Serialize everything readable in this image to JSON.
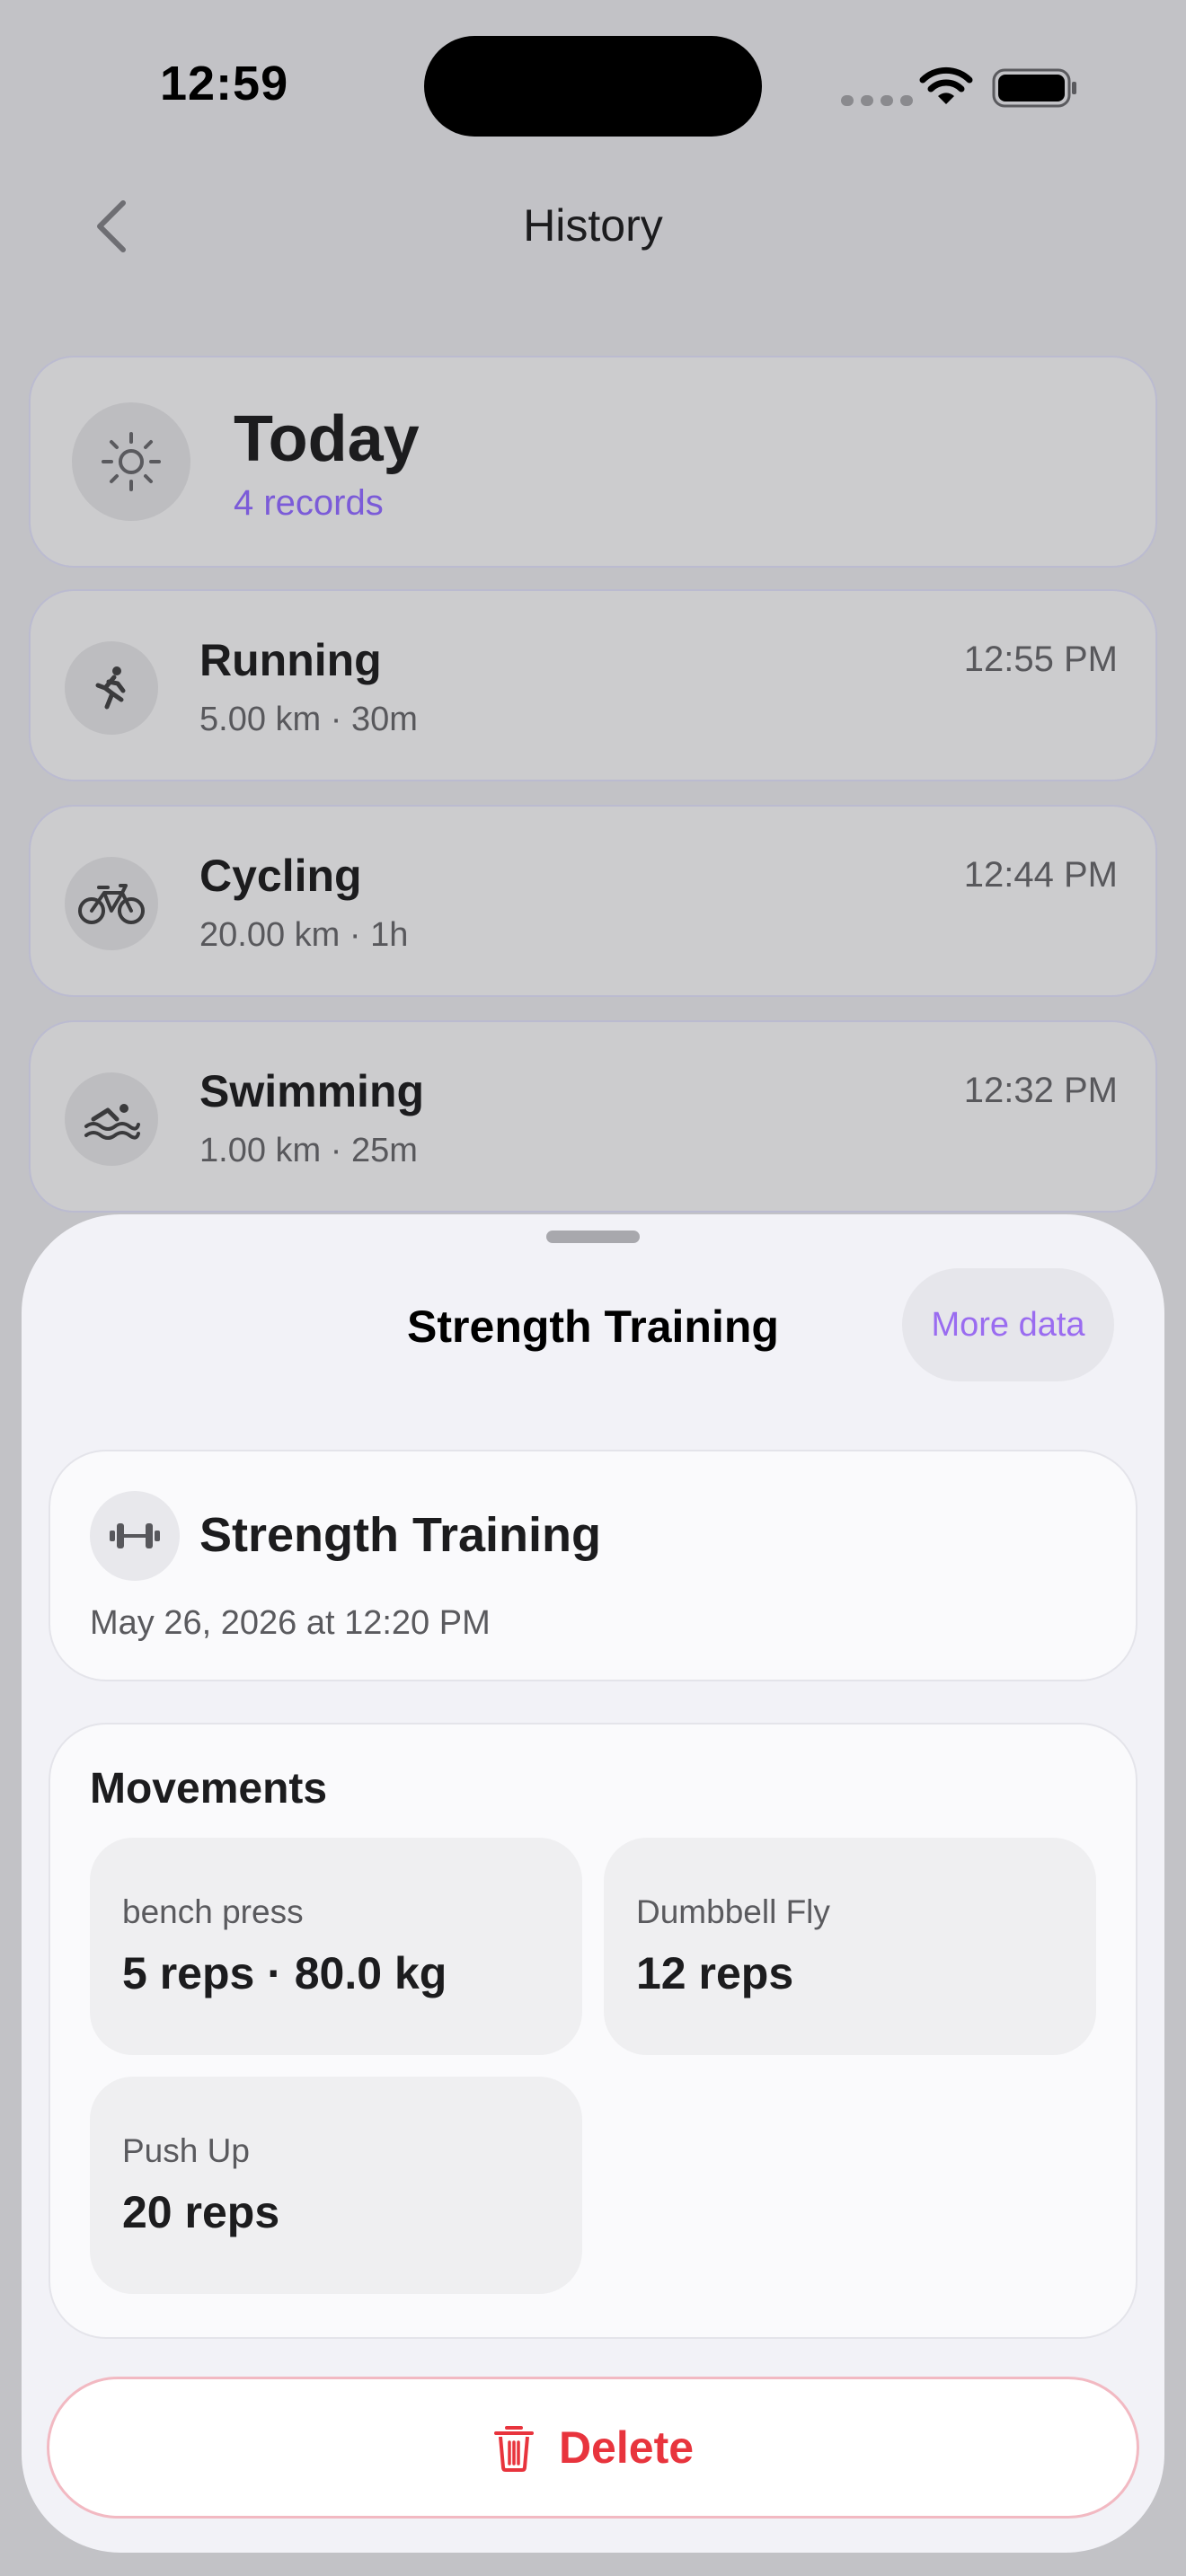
{
  "status_bar": {
    "time": "12:59"
  },
  "nav": {
    "title": "History"
  },
  "today": {
    "title": "Today",
    "count": "4 records"
  },
  "activities": [
    {
      "icon": "running-icon",
      "title": "Running",
      "subtitle": "5.00 km · 30m",
      "time": "12:55 PM"
    },
    {
      "icon": "cycling-icon",
      "title": "Cycling",
      "subtitle": "20.00 km · 1h",
      "time": "12:44 PM"
    },
    {
      "icon": "swimming-icon",
      "title": "Swimming",
      "subtitle": "1.00 km · 25m",
      "time": "12:32 PM"
    }
  ],
  "sheet": {
    "title": "Strength Training",
    "more_data_label": "More data",
    "detail": {
      "icon": "dumbbell-icon",
      "title": "Strength Training",
      "date": "May 26, 2026 at 12:20 PM"
    },
    "movements_title": "Movements",
    "movements": [
      {
        "name": "bench press",
        "value": "5 reps · 80.0 kg"
      },
      {
        "name": "Dumbbell Fly",
        "value": "12 reps"
      },
      {
        "name": "Push Up",
        "value": "20 reps"
      }
    ],
    "delete_label": "Delete"
  },
  "colors": {
    "accent": "#7b5bd8",
    "more_data": "#9a6cf0",
    "destructive": "#e8343d",
    "dimmed_background": "#c2c2c6",
    "sheet_background": "#f2f2f7"
  }
}
